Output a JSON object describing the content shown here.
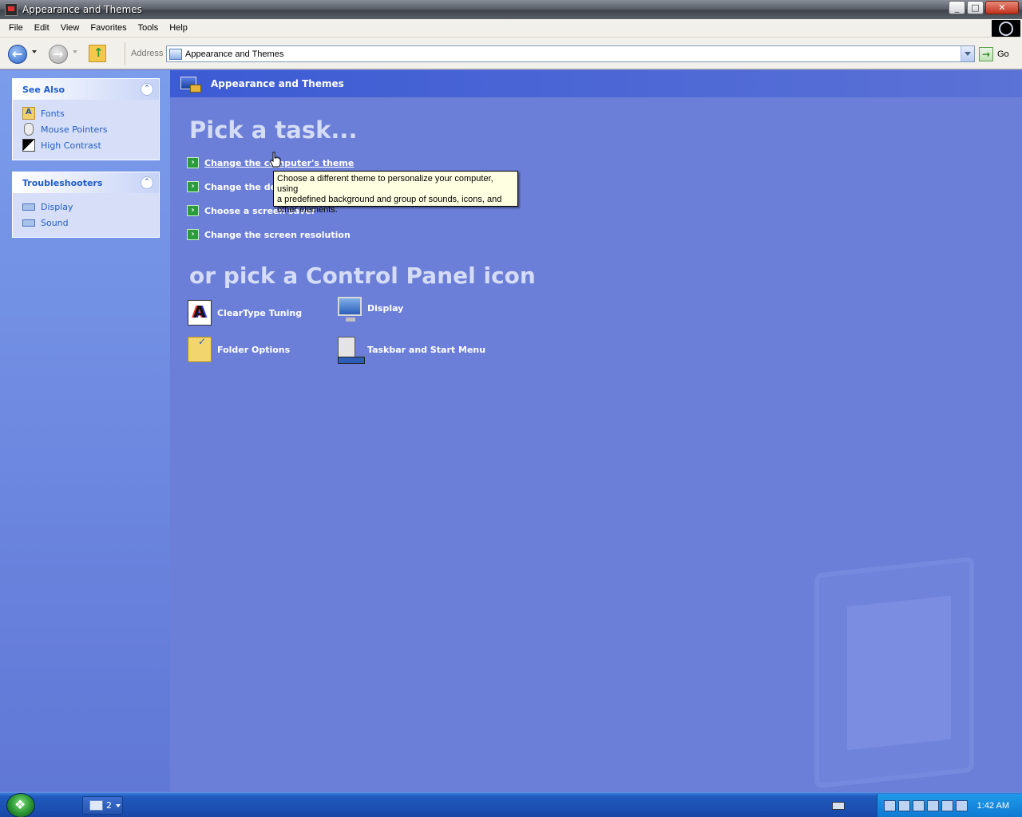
{
  "window": {
    "title": "Appearance and Themes",
    "buttons": {
      "minimize": "_",
      "maximize": "□",
      "close": "✕"
    }
  },
  "menubar": {
    "items": [
      "File",
      "Edit",
      "View",
      "Favorites",
      "Tools",
      "Help"
    ]
  },
  "toolbar": {
    "address_label": "Address",
    "address_value": "Appearance and Themes",
    "go_label": "Go"
  },
  "sidebar": {
    "see_also": {
      "title": "See Also",
      "items": [
        {
          "label": "Fonts",
          "icon": "fonts-icon"
        },
        {
          "label": "Mouse Pointers",
          "icon": "mouse-icon"
        },
        {
          "label": "High Contrast",
          "icon": "high-contrast-icon"
        }
      ]
    },
    "troubleshooters": {
      "title": "Troubleshooters",
      "items": [
        {
          "label": "Display",
          "icon": "troubleshooter-icon"
        },
        {
          "label": "Sound",
          "icon": "troubleshooter-icon"
        }
      ]
    }
  },
  "main": {
    "header_title": "Appearance and Themes",
    "pick_task_heading": "Pick a task...",
    "tasks": [
      "Change the computer's theme",
      "Change the desktop background",
      "Choose a screen saver",
      "Change the screen resolution"
    ],
    "or_heading": "or pick a Control Panel icon",
    "icons": [
      {
        "label": "ClearType Tuning",
        "icon": "cleartype-icon"
      },
      {
        "label": "Display",
        "icon": "display-icon"
      },
      {
        "label": "Folder Options",
        "icon": "folder-options-icon"
      },
      {
        "label": "Taskbar and Start Menu",
        "icon": "taskbar-icon"
      }
    ]
  },
  "tooltip": {
    "line1": "Choose a different theme to personalize your computer, using",
    "line2": "a predefined background and group of sounds, icons, and",
    "line3": "other elements."
  },
  "taskbar": {
    "group_count": "2",
    "clock": "1:42 AM"
  },
  "colors": {
    "content_bg": "#6c7fd8",
    "link_blue": "#215dc6",
    "tooltip_bg": "#ffffe1",
    "taskbar_blue": "#1f5bbd"
  }
}
